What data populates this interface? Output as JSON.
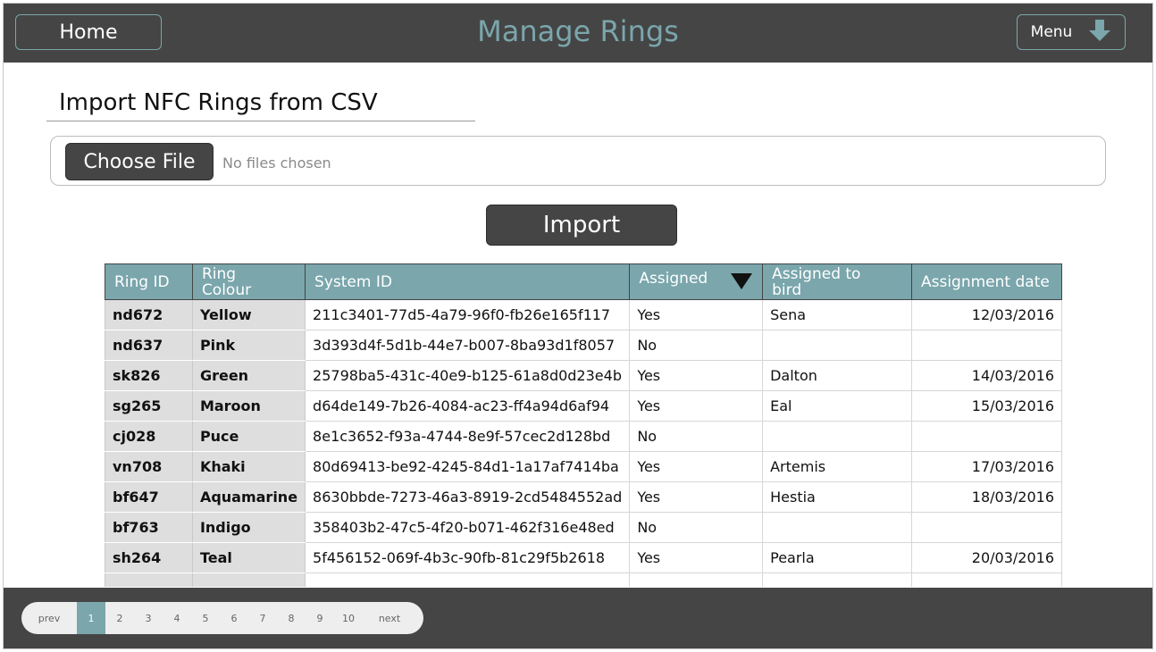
{
  "header": {
    "home_label": "Home",
    "title": "Manage Rings",
    "menu_label": "Menu"
  },
  "import_section": {
    "title": "Import NFC Rings from CSV",
    "choose_file_label": "Choose File",
    "file_status": "No files chosen",
    "import_label": "Import"
  },
  "table": {
    "columns": [
      "Ring ID",
      "Ring Colour",
      "System ID",
      "Assigned",
      "Assigned to bird",
      "Assignment date"
    ],
    "rows": [
      [
        "nd672",
        "Yellow",
        "211c3401-77d5-4a79-96f0-fb26e165f117",
        "Yes",
        "Sena",
        "12/03/2016"
      ],
      [
        "nd637",
        "Pink",
        "3d393d4f-5d1b-44e7-b007-8ba93d1f8057",
        "No",
        "",
        ""
      ],
      [
        "sk826",
        "Green",
        "25798ba5-431c-40e9-b125-61a8d0d23e4b",
        "Yes",
        "Dalton",
        "14/03/2016"
      ],
      [
        "sg265",
        "Maroon",
        "d64de149-7b26-4084-ac23-ff4a94d6af94",
        "Yes",
        "Eal",
        "15/03/2016"
      ],
      [
        "cj028",
        "Puce",
        "8e1c3652-f93a-4744-8e9f-57cec2d128bd",
        "No",
        "",
        ""
      ],
      [
        "vn708",
        "Khaki",
        "80d69413-be92-4245-84d1-1a17af7414ba",
        "Yes",
        "Artemis",
        "17/03/2016"
      ],
      [
        "bf647",
        "Aquamarine",
        "8630bbde-7273-46a3-8919-2cd5484552ad",
        "Yes",
        "Hestia",
        "18/03/2016"
      ],
      [
        "bf763",
        "Indigo",
        "358403b2-47c5-4f20-b071-462f316e48ed",
        "No",
        "",
        ""
      ],
      [
        "sh264",
        "Teal",
        "5f456152-069f-4b3c-90fb-81c29f5b2618",
        "Yes",
        "Pearla",
        "20/03/2016"
      ],
      [
        "",
        "",
        "",
        "",
        "",
        ""
      ]
    ]
  },
  "pagination": {
    "prev": "prev",
    "pages": [
      "1",
      "2",
      "3",
      "4",
      "5",
      "6",
      "7",
      "8",
      "9",
      "10"
    ],
    "next": "next",
    "current": "1"
  },
  "colors": {
    "header_bg": "#454545",
    "accent": "#7aa6ac"
  },
  "icons": {
    "menu": "arrow-down-icon",
    "sort": "triangle-down-icon"
  }
}
